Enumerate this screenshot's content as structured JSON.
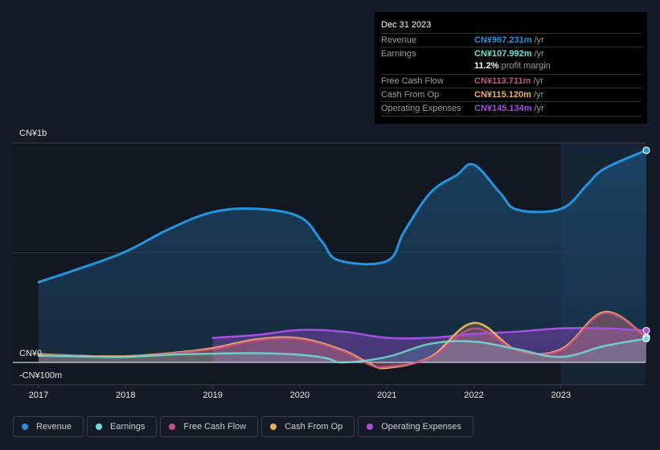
{
  "tooltip": {
    "date": "Dec 31 2023",
    "rows": [
      {
        "label": "Revenue",
        "value": "CN¥967.231m",
        "unit": "/yr",
        "color": "#2394df"
      },
      {
        "label": "Earnings",
        "value": "CN¥107.992m",
        "unit": "/yr",
        "color": "#6de0d2"
      },
      {
        "label": "Free Cash Flow",
        "value": "CN¥113.711m",
        "unit": "/yr",
        "color": "#c6508a"
      },
      {
        "label": "Cash From Op",
        "value": "CN¥115.120m",
        "unit": "/yr",
        "color": "#e8b062"
      },
      {
        "label": "Operating Expenses",
        "value": "CN¥145.134m",
        "unit": "/yr",
        "color": "#a64ee6"
      }
    ],
    "profit_margin_value": "11.2%",
    "profit_margin_label": "profit margin"
  },
  "legend": [
    {
      "label": "Revenue",
      "color": "#2394df"
    },
    {
      "label": "Earnings",
      "color": "#6de0d2"
    },
    {
      "label": "Free Cash Flow",
      "color": "#c6508a"
    },
    {
      "label": "Cash From Op",
      "color": "#e8b062"
    },
    {
      "label": "Operating Expenses",
      "color": "#a64ee6"
    }
  ],
  "chart_data": {
    "type": "area",
    "title": "",
    "xlabel": "",
    "ylabel": "",
    "units": "CN¥ millions",
    "x_ticks": [
      "2017",
      "2018",
      "2019",
      "2020",
      "2021",
      "2022",
      "2023"
    ],
    "y_ticks": [
      {
        "label": "CN¥1b",
        "value": 1000
      },
      {
        "label": "CN¥0",
        "value": 0
      },
      {
        "label": "-CN¥100m",
        "value": -100
      }
    ],
    "xlim": [
      2017,
      2023.98
    ],
    "ylim": [
      -100,
      1000
    ],
    "forecast_shading_start": 2023,
    "series": [
      {
        "name": "Revenue",
        "color": "#2394df",
        "x": [
          2017.0,
          2017.5,
          2018.0,
          2018.5,
          2019.0,
          2019.5,
          2020.0,
          2020.25,
          2020.45,
          2021.0,
          2021.2,
          2021.5,
          2021.8,
          2022.0,
          2022.3,
          2022.5,
          2023.0,
          2023.3,
          2023.5,
          2023.98
        ],
        "values": [
          366,
          432,
          505,
          608,
          685,
          700,
          663,
          553,
          465,
          462,
          597,
          773,
          853,
          901,
          773,
          696,
          700,
          810,
          883,
          967
        ]
      },
      {
        "name": "Earnings",
        "color": "#6de0d2",
        "x": [
          2017.0,
          2017.5,
          2018.0,
          2018.5,
          2019.0,
          2019.5,
          2020.0,
          2020.3,
          2020.5,
          2021.0,
          2021.5,
          2022.0,
          2022.5,
          2023.0,
          2023.5,
          2023.98
        ],
        "values": [
          30,
          27,
          25,
          35,
          40,
          42,
          35,
          20,
          0,
          25,
          85,
          95,
          60,
          25,
          75,
          108
        ]
      },
      {
        "name": "Free Cash Flow",
        "color": "#c6508a",
        "x": [
          2017.0,
          2017.5,
          2018.0,
          2018.5,
          2019.0,
          2019.5,
          2020.0,
          2020.5,
          2020.8,
          2021.0,
          2021.5,
          2022.0,
          2022.5,
          2023.0,
          2023.5,
          2023.98
        ],
        "values": [
          35,
          28,
          25,
          40,
          60,
          100,
          105,
          50,
          -10,
          -20,
          20,
          155,
          55,
          55,
          225,
          114
        ]
      },
      {
        "name": "Cash From Op",
        "color": "#e8b062",
        "x": [
          2017.0,
          2017.5,
          2018.0,
          2018.5,
          2019.0,
          2019.5,
          2020.0,
          2020.5,
          2020.8,
          2021.0,
          2021.5,
          2022.0,
          2022.5,
          2023.0,
          2023.5,
          2023.98
        ],
        "values": [
          38,
          30,
          28,
          42,
          65,
          105,
          110,
          55,
          -5,
          -25,
          25,
          180,
          55,
          60,
          230,
          115
        ]
      },
      {
        "name": "Operating Expenses",
        "color": "#a64ee6",
        "x": [
          2019.0,
          2019.5,
          2020.0,
          2020.5,
          2021.0,
          2021.5,
          2022.0,
          2022.5,
          2023.0,
          2023.5,
          2023.98
        ],
        "values": [
          112,
          125,
          148,
          140,
          112,
          112,
          130,
          140,
          155,
          155,
          145
        ]
      }
    ]
  }
}
